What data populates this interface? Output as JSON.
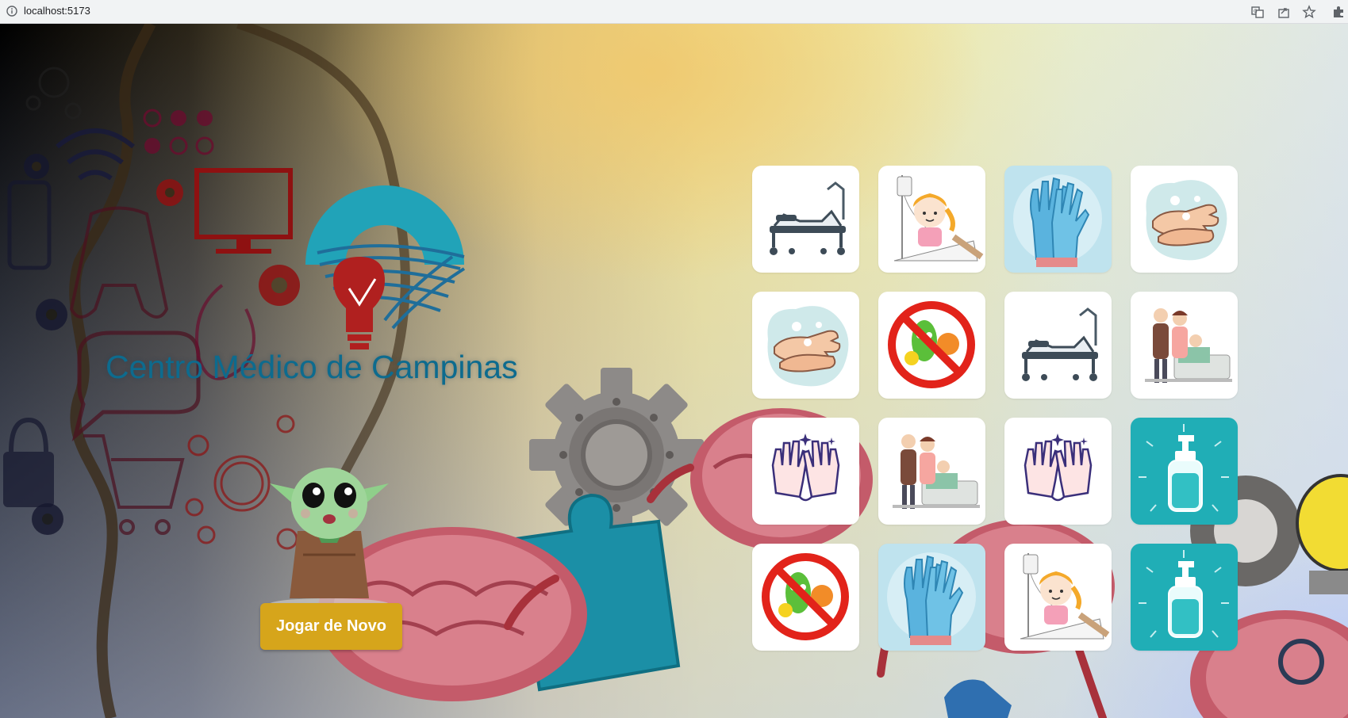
{
  "browser": {
    "url": "localhost:5173"
  },
  "page": {
    "title": "Centro Médico de Campinas",
    "replay_label": "Jogar de Novo"
  },
  "cards": [
    {
      "image": "hospital-bed-icon",
      "background": "#ffffff"
    },
    {
      "image": "sick-child-iv-icon",
      "background": "#ffffff"
    },
    {
      "image": "blue-gloves-icon",
      "background": "#bfe3ee"
    },
    {
      "image": "handwashing-icon",
      "background": "#ffffff"
    },
    {
      "image": "handwashing-icon",
      "background": "#ffffff"
    },
    {
      "image": "no-germs-icon",
      "background": "#ffffff"
    },
    {
      "image": "hospital-bed-icon",
      "background": "#ffffff"
    },
    {
      "image": "family-visit-icon",
      "background": "#ffffff"
    },
    {
      "image": "clean-hands-icon",
      "background": "#ffffff"
    },
    {
      "image": "family-visit-icon",
      "background": "#ffffff"
    },
    {
      "image": "clean-hands-icon",
      "background": "#ffffff"
    },
    {
      "image": "hand-sanitizer-icon",
      "background": "#20aeb6"
    },
    {
      "image": "no-germs-icon",
      "background": "#ffffff"
    },
    {
      "image": "blue-gloves-icon",
      "background": "#bfe3ee"
    },
    {
      "image": "sick-child-iv-icon",
      "background": "#ffffff"
    },
    {
      "image": "hand-sanitizer-icon",
      "background": "#20aeb6"
    }
  ],
  "colors": {
    "accent_button": "#d6a51b",
    "title": "#0d6b8e",
    "logo_teal": "#21a3b8",
    "logo_red": "#b0201f"
  }
}
